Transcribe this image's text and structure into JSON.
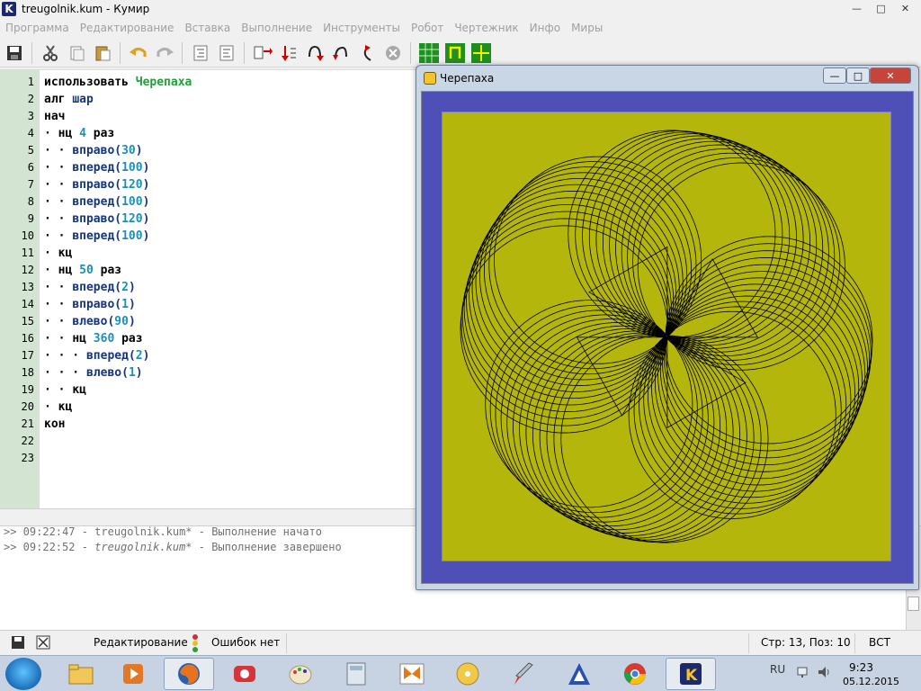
{
  "window": {
    "title": "treugolnik.kum - Кумир",
    "app_icon_letter": "K"
  },
  "menu": [
    "Программа",
    "Редактирование",
    "Вставка",
    "Выполнение",
    "Инструменты",
    "Робот",
    "Чертежник",
    "Инфо",
    "Миры"
  ],
  "toolbar_icons": [
    "save-icon",
    "cut-icon",
    "copy-icon",
    "paste-icon",
    "undo-icon",
    "redo-icon",
    "indent-icon",
    "unindent-icon",
    "run-icon",
    "step-in-icon",
    "step-over-icon",
    "step-out-icon",
    "step-back-icon",
    "stop-icon",
    "grid-icon",
    "frame-icon",
    "cross-grid-icon"
  ],
  "editor": {
    "line_numbers": [
      "1",
      "2",
      "3",
      "4",
      "5",
      "6",
      "7",
      "8",
      "9",
      "10",
      "11",
      "12",
      "13",
      "14",
      "15",
      "16",
      "17",
      "18",
      "19",
      "20",
      "21",
      "22",
      "23"
    ],
    "lines": [
      [
        {
          "t": "использовать ",
          "c": "kw"
        },
        {
          "t": "Черепаха",
          "c": "mod"
        }
      ],
      [
        {
          "t": "алг ",
          "c": "kw"
        },
        {
          "t": "шар",
          "c": "fn"
        }
      ],
      [
        {
          "t": "нач",
          "c": "kw"
        }
      ],
      [
        {
          "t": "· ",
          "c": "dot"
        },
        {
          "t": "нц ",
          "c": "kw"
        },
        {
          "t": "4",
          "c": "num"
        },
        {
          "t": " раз",
          "c": "kw"
        }
      ],
      [
        {
          "t": "· · ",
          "c": "dot"
        },
        {
          "t": "вправо",
          "c": "fn"
        },
        {
          "t": "(",
          "c": "fn"
        },
        {
          "t": "30",
          "c": "num"
        },
        {
          "t": ")",
          "c": "fn"
        }
      ],
      [
        {
          "t": "· · ",
          "c": "dot"
        },
        {
          "t": "вперед",
          "c": "fn"
        },
        {
          "t": "(",
          "c": "fn"
        },
        {
          "t": "100",
          "c": "num"
        },
        {
          "t": ")",
          "c": "fn"
        }
      ],
      [
        {
          "t": "· · ",
          "c": "dot"
        },
        {
          "t": "вправо",
          "c": "fn"
        },
        {
          "t": "(",
          "c": "fn"
        },
        {
          "t": "120",
          "c": "num"
        },
        {
          "t": ")",
          "c": "fn"
        }
      ],
      [
        {
          "t": "· · ",
          "c": "dot"
        },
        {
          "t": "вперед",
          "c": "fn"
        },
        {
          "t": "(",
          "c": "fn"
        },
        {
          "t": "100",
          "c": "num"
        },
        {
          "t": ")",
          "c": "fn"
        }
      ],
      [
        {
          "t": "· · ",
          "c": "dot"
        },
        {
          "t": "вправо",
          "c": "fn"
        },
        {
          "t": "(",
          "c": "fn"
        },
        {
          "t": "120",
          "c": "num"
        },
        {
          "t": ")",
          "c": "fn"
        }
      ],
      [
        {
          "t": "· · ",
          "c": "dot"
        },
        {
          "t": "вперед",
          "c": "fn"
        },
        {
          "t": "(",
          "c": "fn"
        },
        {
          "t": "100",
          "c": "num"
        },
        {
          "t": ")",
          "c": "fn"
        }
      ],
      [
        {
          "t": "· ",
          "c": "dot"
        },
        {
          "t": "кц",
          "c": "kw"
        }
      ],
      [
        {
          "t": "· ",
          "c": "dot"
        },
        {
          "t": "нц ",
          "c": "kw"
        },
        {
          "t": "50",
          "c": "num"
        },
        {
          "t": " раз",
          "c": "kw"
        }
      ],
      [
        {
          "t": "· · ",
          "c": "dot"
        },
        {
          "t": "вперед",
          "c": "fn"
        },
        {
          "t": "(",
          "c": "fn"
        },
        {
          "t": "2",
          "c": "num"
        },
        {
          "t": ")",
          "c": "fn"
        }
      ],
      [
        {
          "t": "· · ",
          "c": "dot"
        },
        {
          "t": "вправо",
          "c": "fn"
        },
        {
          "t": "(",
          "c": "fn"
        },
        {
          "t": "1",
          "c": "num"
        },
        {
          "t": ")",
          "c": "fn"
        }
      ],
      [
        {
          "t": "· · ",
          "c": "dot"
        },
        {
          "t": "влево",
          "c": "fn"
        },
        {
          "t": "(",
          "c": "fn"
        },
        {
          "t": "90",
          "c": "num"
        },
        {
          "t": ")",
          "c": "fn"
        }
      ],
      [
        {
          "t": "· · ",
          "c": "dot"
        },
        {
          "t": "нц ",
          "c": "kw"
        },
        {
          "t": "360",
          "c": "num"
        },
        {
          "t": " раз",
          "c": "kw"
        }
      ],
      [
        {
          "t": "· · · ",
          "c": "dot"
        },
        {
          "t": "вперед",
          "c": "fn"
        },
        {
          "t": "(",
          "c": "fn"
        },
        {
          "t": "2",
          "c": "num"
        },
        {
          "t": ")",
          "c": "fn"
        }
      ],
      [
        {
          "t": "· · · ",
          "c": "dot"
        },
        {
          "t": "влево",
          "c": "fn"
        },
        {
          "t": "(",
          "c": "fn"
        },
        {
          "t": "1",
          "c": "num"
        },
        {
          "t": ")",
          "c": "fn"
        }
      ],
      [
        {
          "t": "· · ",
          "c": "dot"
        },
        {
          "t": "кц",
          "c": "kw"
        }
      ],
      [
        {
          "t": "· ",
          "c": "dot"
        },
        {
          "t": "кц",
          "c": "kw"
        }
      ],
      [
        {
          "t": "кон",
          "c": "kw"
        }
      ],
      [],
      []
    ]
  },
  "log": {
    "line1": ">> 09:22:47 - treugolnik.kum* - Выполнение начато",
    "line2_prefix": ">> 09:22:52 - ",
    "line2_file": "treugolnik.kum*",
    "line2_suffix": " - Выполнение завершено"
  },
  "status": {
    "mode": "Редактирование",
    "errors": "Ошибок нет",
    "position": "Стр: 13, Поз: 10",
    "insert_mode": "ВСТ"
  },
  "turtle_window": {
    "title": "Черепаха",
    "canvas_color": "#b5b60b",
    "border_color": "#4f4fb8"
  },
  "taskbar": {
    "apps": [
      "explorer-icon",
      "media-player-icon",
      "firefox-icon",
      "presentation-icon",
      "paint-icon",
      "calculator-icon",
      "butterfly-icon",
      "disc-icon",
      "rocket-icon",
      "alt-linux-icon",
      "chrome-icon",
      "kumir-icon"
    ],
    "lang": "RU",
    "time": "9:23",
    "date": "05.12.2015"
  }
}
